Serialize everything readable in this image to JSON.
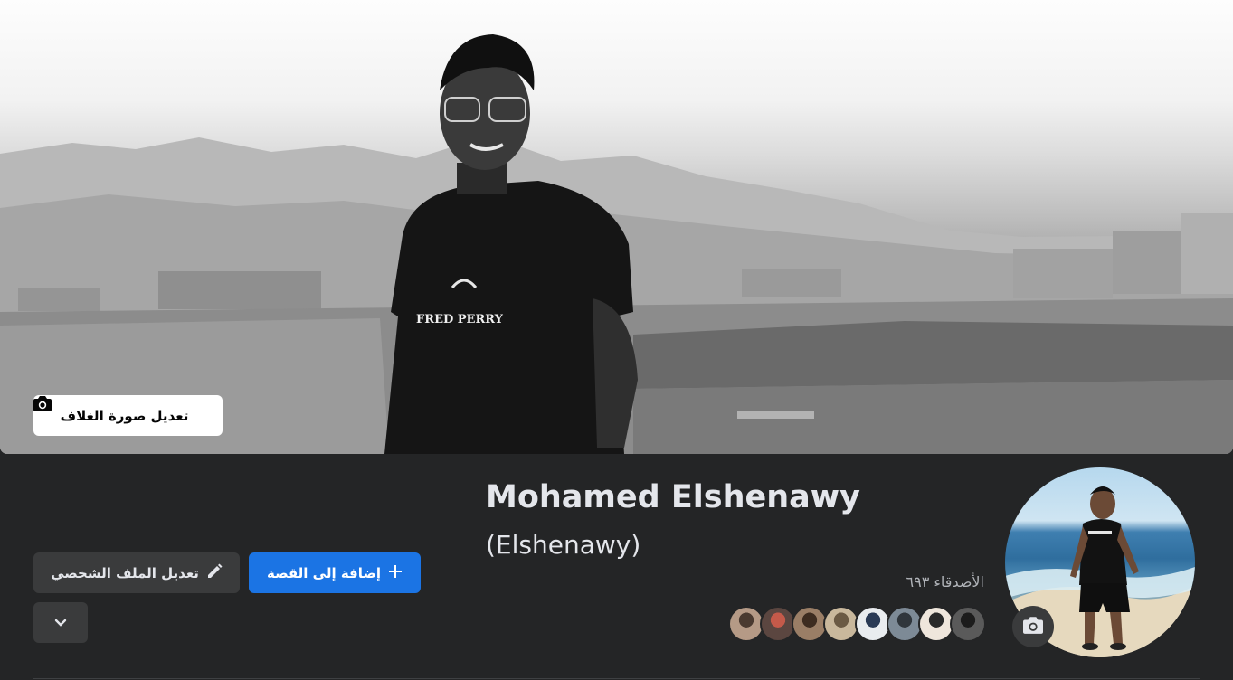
{
  "cover": {
    "edit_label": "تعديل صورة الغلاف",
    "shirt_text": "FRED PERRY"
  },
  "profile": {
    "name": "Mohamed Elshenawy",
    "alternate_name": "(Elshenawy)",
    "friends_label": "الأصدقاء ٦٩٣",
    "friend_avatar_count": 8
  },
  "actions": {
    "add_story_label": "إضافة إلى القصة",
    "edit_profile_label": "تعديل الملف الشخصي",
    "more_icon": "chevron-down-icon"
  },
  "colors": {
    "primary": "#1b74e4",
    "surface": "#242526",
    "secondary_button": "#3a3b3c",
    "text_primary": "#e4e6eb",
    "text_secondary": "#b0b3b8"
  },
  "friend_avatars": [
    {
      "bg": "#5a5a5a",
      "fg": "#1c1c1c"
    },
    {
      "bg": "#efe6dc",
      "fg": "#2a2a2a"
    },
    {
      "bg": "#7d8a96",
      "fg": "#30363c"
    },
    {
      "bg": "#e9ecef",
      "fg": "#2a3a55"
    },
    {
      "bg": "#c9b89c",
      "fg": "#6b5a44"
    },
    {
      "bg": "#9a7e66",
      "fg": "#3d2c20"
    },
    {
      "bg": "#5b4640",
      "fg": "#c45a4a"
    },
    {
      "bg": "#b59a86",
      "fg": "#4a3a30"
    }
  ]
}
